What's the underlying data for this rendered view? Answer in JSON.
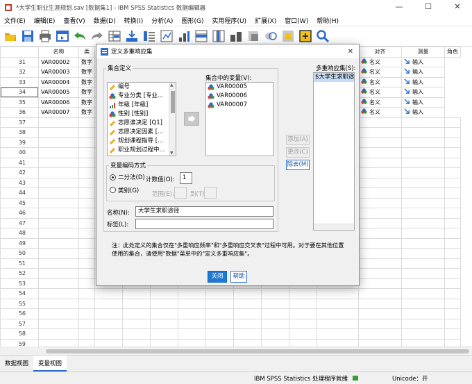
{
  "window": {
    "title": "*大学生职业生涯规划.sav [数据集1] - IBM SPSS Statistics 数据编辑器",
    "controls": [
      "—",
      "☐",
      "✕"
    ]
  },
  "menu": [
    "文件(E)",
    "编辑(E)",
    "查看(V)",
    "数据(D)",
    "转换(I)",
    "分析(A)",
    "图形(G)",
    "实用程序(U)",
    "扩展(X)",
    "窗口(W)",
    "帮助(H)"
  ],
  "toolbar": {
    "icons": [
      "open-icon",
      "save-icon",
      "print-icon",
      "dialog-recall-icon",
      "undo-icon",
      "redo-icon",
      "goto-case-icon",
      "goto-variable-icon",
      "variables-icon",
      "run-descriptives-icon",
      "find-icon",
      "insert-cases-icon",
      "split-file-icon",
      "weight-cases-icon",
      "select-cases-icon",
      "value-labels-icon",
      "use-sets-icon",
      "show-all-variables-icon",
      "search-icon"
    ],
    "colors": {
      "blue": "#2c6ccf",
      "green": "#3a9a3a",
      "orange": "#e2901c",
      "yellow": "#f1c21b"
    }
  },
  "grid": {
    "headers": [
      "名称",
      "类",
      "",
      "",
      "",
      "",
      "",
      "",
      "",
      "",
      "",
      "对齐",
      "测量",
      "角色"
    ],
    "rows": [
      {
        "n": "31",
        "name": "VAR00002",
        "type": "数字",
        "measure": "名义",
        "role": "输入"
      },
      {
        "n": "32",
        "name": "VAR00003",
        "type": "数字",
        "measure": "名义",
        "role": "输入"
      },
      {
        "n": "33",
        "name": "VAR00004",
        "type": "数字",
        "measure": "名义",
        "role": "输入"
      },
      {
        "n": "34",
        "name": "VAR00005",
        "type": "数字",
        "measure": "名义",
        "role": "输入"
      },
      {
        "n": "35",
        "name": "VAR00006",
        "type": "数字",
        "measure": "名义",
        "role": "输入"
      },
      {
        "n": "36",
        "name": "VAR00007",
        "type": "数字",
        "measure": "名义",
        "role": "输入"
      }
    ],
    "empty_rows": [
      "37",
      "38",
      "39",
      "40",
      "41",
      "42",
      "43",
      "44",
      "45",
      "46",
      "47",
      "48",
      "49",
      "50",
      "51",
      "52",
      "53",
      "54",
      "55",
      "56",
      "57",
      "58",
      "59"
    ],
    "selected_row": "34"
  },
  "dialog": {
    "title": "定义多重响应集",
    "set_definition_label": "集合定义",
    "source_variables": [
      {
        "label": "编号",
        "icon": "scale-icon"
      },
      {
        "label": "专业分类 [专业...",
        "icon": "nominal-icon"
      },
      {
        "label": "年级 [年级]",
        "icon": "ordinal-icon"
      },
      {
        "label": "性别 [性别]",
        "icon": "nominal-icon"
      },
      {
        "label": "志愿谁决定 [Q1]",
        "icon": "scale-icon"
      },
      {
        "label": "志愿决定因素 [...",
        "icon": "scale-icon"
      },
      {
        "label": "规划课程指导 [...",
        "icon": "scale-icon"
      },
      {
        "label": "职业规划过程中...",
        "icon": "scale-icon"
      }
    ],
    "vars_in_set_label": "集合中的变量(V):",
    "vars_in_set": [
      "VAR00005",
      "VAR00006",
      "VAR00007"
    ],
    "coding_label": "变量编码方式",
    "dichotomy_label": "二分法(D)",
    "counted_value_label": "计数值(O):",
    "counted_value": "1",
    "categories_label": "类别(G)",
    "range_label": "范围(E):",
    "range_through_label": "到(T)",
    "name_label": "名称(N):",
    "name_value": "大学生求职途径",
    "label_label": "标签(L):",
    "label_value": "",
    "mr_sets_label": "多重响应集(S):",
    "mr_sets": [
      "$大学生求职途"
    ],
    "add_label": "添加(A)",
    "change_label": "更改(C)",
    "remove_label": "除去(M)",
    "note": "注：此处定义的集合仅在\"多重响应频率\"和\"多重响应交叉表\"过程中可用。对于要在其他位置使用的集合，请使用\"数据\"菜单中的\"定义多重响应集\"。",
    "close_label": "关闭",
    "help_label": "帮助"
  },
  "tabs": [
    "数据视图",
    "变量视图"
  ],
  "active_tab": "变量视图",
  "status": {
    "processor": "IBM SPSS Statistics 处理程序就绪",
    "unicode": "Unicode：开"
  }
}
